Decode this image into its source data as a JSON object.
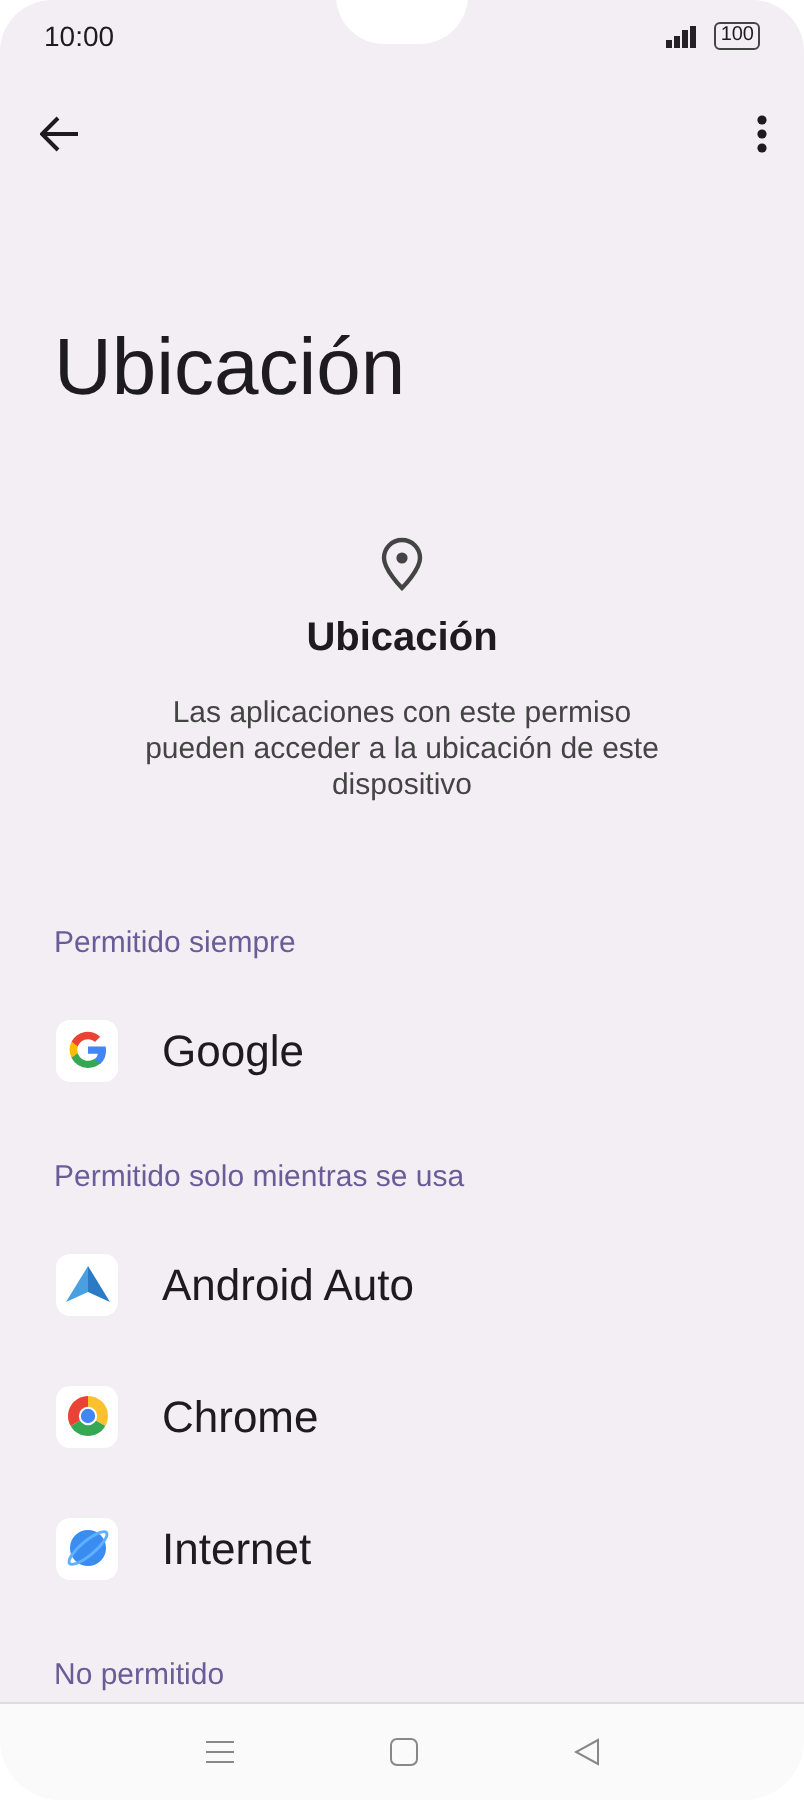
{
  "status_bar": {
    "time": "10:00",
    "battery": "100"
  },
  "page": {
    "title": "Ubicación"
  },
  "header": {
    "title": "Ubicación",
    "description": "Las aplicaciones con este permiso pueden acceder a la ubicación de este dispositivo"
  },
  "sections": [
    {
      "title": "Permitido siempre",
      "apps": [
        {
          "name": "Google"
        }
      ]
    },
    {
      "title": "Permitido solo mientras se usa",
      "apps": [
        {
          "name": "Android Auto"
        },
        {
          "name": "Chrome"
        },
        {
          "name": "Internet"
        }
      ]
    },
    {
      "title": "No permitido"
    }
  ]
}
